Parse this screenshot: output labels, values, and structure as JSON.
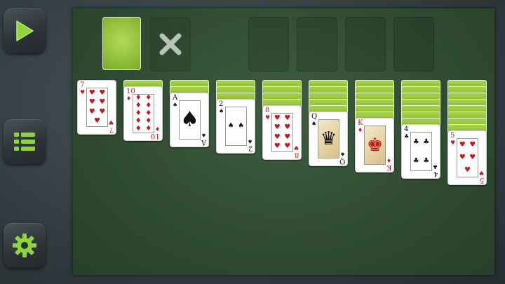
{
  "sidebar": {
    "play_icon": "play-icon",
    "menu_icon": "menu-list-icon",
    "settings_icon": "gear-icon",
    "icon_color": "#8fd43a"
  },
  "waste": {
    "icon": "close-icon"
  },
  "tableau": [
    {
      "hidden": 0,
      "card": {
        "rank": "7",
        "suit": "♥",
        "color": "red"
      }
    },
    {
      "hidden": 1,
      "card": {
        "rank": "10",
        "suit": "♦",
        "color": "red"
      }
    },
    {
      "hidden": 2,
      "card": {
        "rank": "A",
        "suit": "♠",
        "color": "black"
      }
    },
    {
      "hidden": 3,
      "card": {
        "rank": "2",
        "suit": "♠",
        "color": "black"
      }
    },
    {
      "hidden": 4,
      "card": {
        "rank": "8",
        "suit": "♥",
        "color": "red"
      }
    },
    {
      "hidden": 5,
      "card": {
        "rank": "Q",
        "suit": "♠",
        "color": "black",
        "face": "♛"
      }
    },
    {
      "hidden": 6,
      "card": {
        "rank": "K",
        "suit": "♦",
        "color": "red",
        "face": "♚"
      }
    },
    {
      "hidden": 7,
      "card": {
        "rank": "4",
        "suit": "♣",
        "color": "black"
      }
    },
    {
      "hidden": 8,
      "card": {
        "rank": "5",
        "suit": "♥",
        "color": "red"
      }
    }
  ]
}
